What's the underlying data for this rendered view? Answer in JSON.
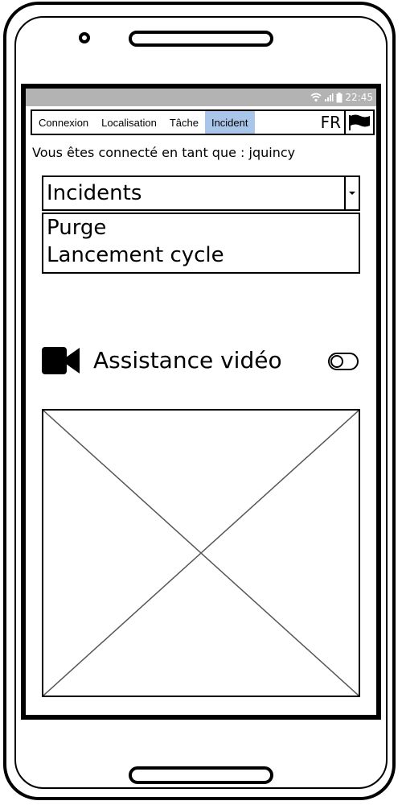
{
  "status_bar": {
    "time": "22:45"
  },
  "tabs": [
    {
      "label": "Connexion",
      "active": false
    },
    {
      "label": "Localisation",
      "active": false
    },
    {
      "label": "Tâche",
      "active": false
    },
    {
      "label": "Incident",
      "active": true
    }
  ],
  "language": {
    "code": "FR",
    "flag_icon": "flag-icon"
  },
  "user_line": "Vous êtes connecté en tant que : jquincy",
  "incident_select": {
    "value": "Incidents",
    "options": [
      "Purge",
      "Lancement cycle"
    ]
  },
  "video_assistance": {
    "icon": "video-camera-icon",
    "label": "Assistance vidéo",
    "toggle_on": false
  },
  "image_placeholder": {
    "icon": "image-placeholder-icon"
  },
  "colors": {
    "active_tab": "#a9c6ea",
    "status_bar": "#b3b3b3",
    "stroke": "#000000"
  }
}
